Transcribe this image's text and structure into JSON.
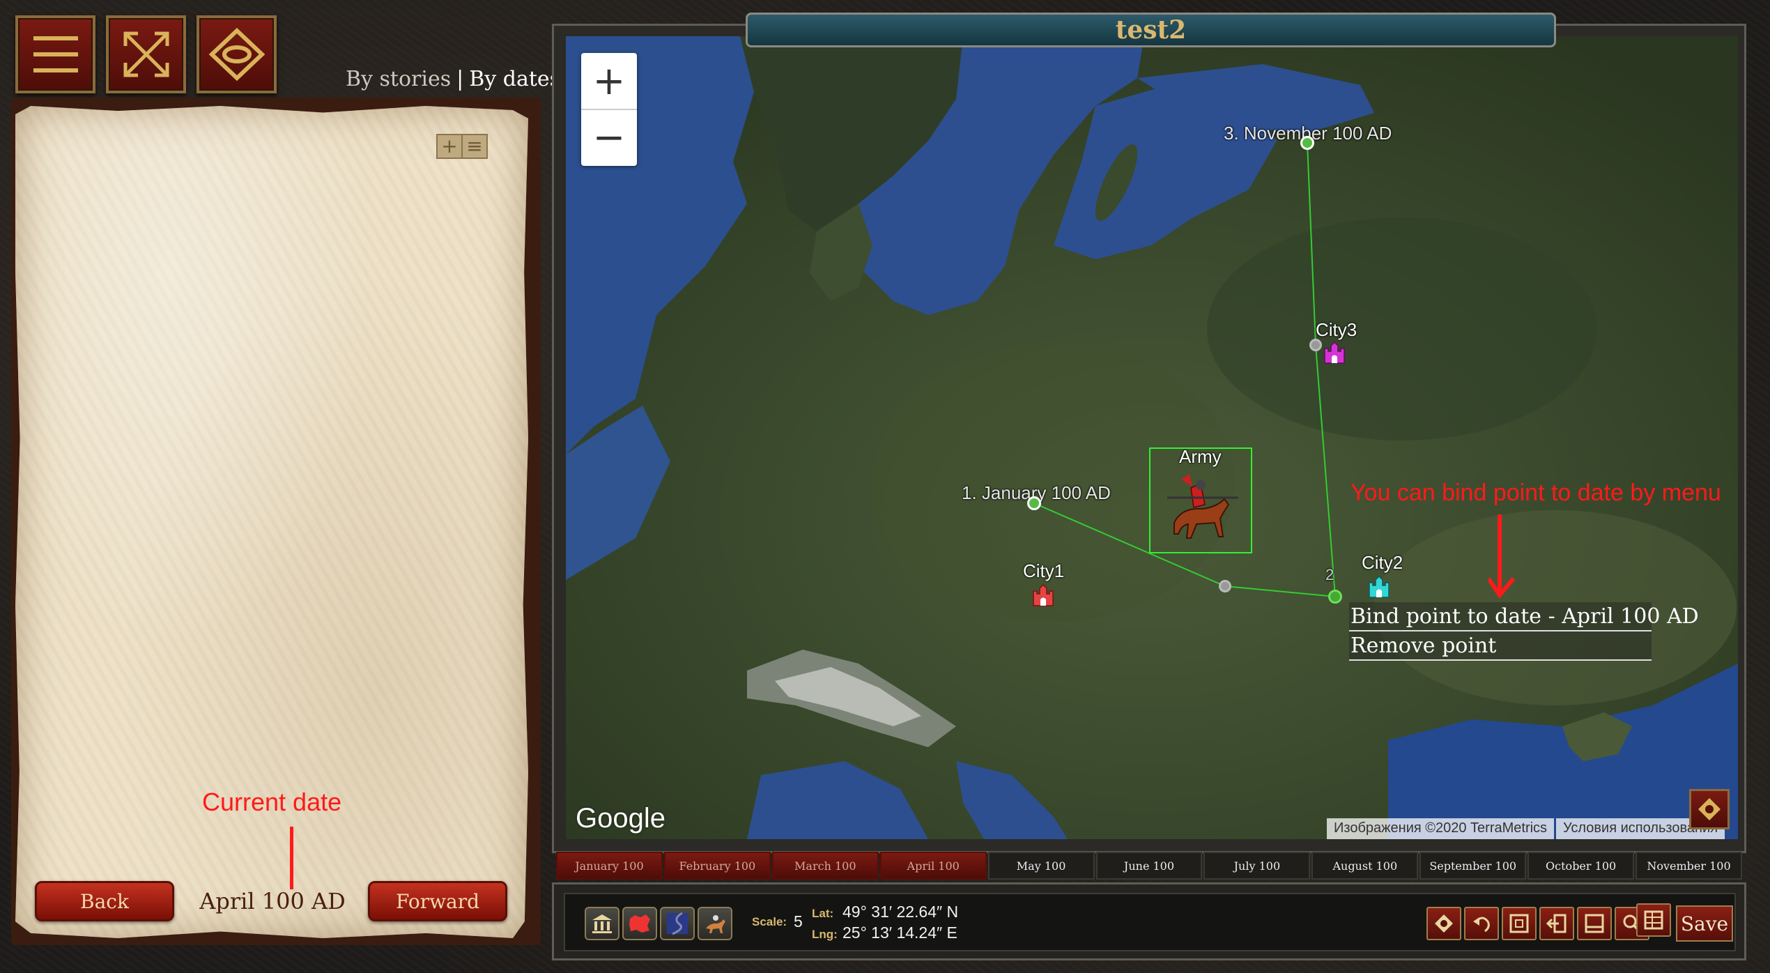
{
  "header": {
    "view_by_stories": "By stories",
    "view_separator": "|",
    "view_by_dates": "By dates"
  },
  "icons": {
    "menu": "hamburger-menu-icon",
    "expand": "fullscreen-expand-icon",
    "diamond": "diamond-compass-icon"
  },
  "panel": {
    "tools_add": "+",
    "tools_list": "≡",
    "annotation": "Current date",
    "current_date": "April 100 AD",
    "back_label": "Back",
    "forward_label": "Forward"
  },
  "map": {
    "title": "test2",
    "zoom_in": "+",
    "zoom_out": "−",
    "points": [
      {
        "label": "1. January 100 AD"
      },
      {
        "label": "3. November 100 AD"
      },
      {
        "label": "2"
      }
    ],
    "cities": [
      {
        "name": "City1",
        "color": "#e44444"
      },
      {
        "name": "City2",
        "color": "#33d6d6"
      },
      {
        "name": "City3",
        "color": "#d633d6"
      }
    ],
    "army_label": "Army",
    "annotation": "You can bind point to date by menu",
    "context_menu": [
      "Bind point to date - April 100 AD",
      "Remove point"
    ],
    "google_logo": "Google",
    "attribution": "Изображения ©2020 TerraMetrics",
    "terms": "Условия использования"
  },
  "timeline": {
    "months": [
      {
        "label": "January 100",
        "state": "past"
      },
      {
        "label": "February 100",
        "state": "past"
      },
      {
        "label": "March 100",
        "state": "past"
      },
      {
        "label": "April 100",
        "state": "past"
      },
      {
        "label": "May 100",
        "state": "future"
      },
      {
        "label": "June 100",
        "state": "future"
      },
      {
        "label": "July 100",
        "state": "future"
      },
      {
        "label": "August 100",
        "state": "future"
      },
      {
        "label": "September 100",
        "state": "future"
      },
      {
        "label": "October 100",
        "state": "future"
      },
      {
        "label": "November 100",
        "state": "future"
      }
    ]
  },
  "toolbar": {
    "scale_label": "Scale:",
    "scale_value": "5",
    "lat_label": "Lat:",
    "lat_value": "49° 31′ 22.64″ N",
    "lng_label": "Lng:",
    "lng_value": "25° 13′ 14.24″ E",
    "save_label": "Save",
    "layer_icons": [
      "buildings-layer-icon",
      "territory-layer-icon",
      "rivers-layer-icon",
      "army-layer-icon"
    ],
    "tool_icons": [
      "settings-icon",
      "undo-icon",
      "frame-icon",
      "exit-icon",
      "layout-icon",
      "search-icon",
      "table-icon"
    ]
  },
  "colors": {
    "accent_red": "#ff1a1a",
    "route_green": "#33cc33",
    "title_gold": "#d8b870",
    "button_red": "#7a1a12"
  }
}
